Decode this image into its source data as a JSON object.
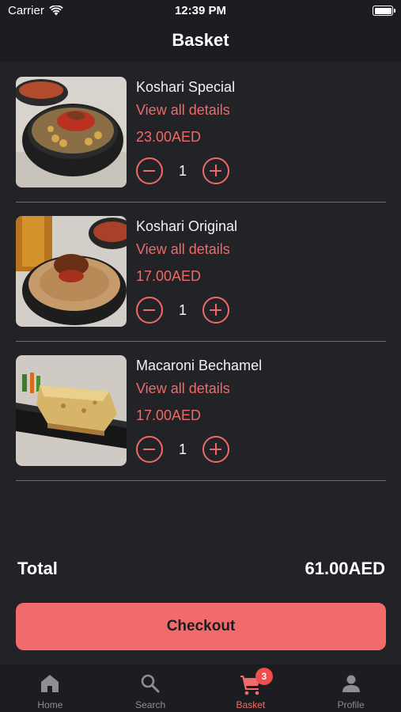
{
  "status_bar": {
    "carrier": "Carrier",
    "time": "12:39 PM"
  },
  "header": {
    "title": "Basket"
  },
  "items": [
    {
      "name": "Koshari Special",
      "link": "View all details",
      "price": "23.00AED",
      "quantity": "1",
      "image": "koshari-special-photo"
    },
    {
      "name": "Koshari Original",
      "link": "View all details",
      "price": "17.00AED",
      "quantity": "1",
      "image": "koshari-original-photo"
    },
    {
      "name": "Macaroni Bechamel",
      "link": "View all details",
      "price": "17.00AED",
      "quantity": "1",
      "image": "macaroni-bechamel-photo"
    }
  ],
  "summary": {
    "total_label": "Total",
    "total_value": "61.00AED"
  },
  "checkout": {
    "label": "Checkout"
  },
  "tabs": [
    {
      "label": "Home",
      "icon": "home-icon"
    },
    {
      "label": "Search",
      "icon": "search-icon"
    },
    {
      "label": "Basket",
      "icon": "cart-icon",
      "badge": "3",
      "active": true
    },
    {
      "label": "Profile",
      "icon": "person-icon"
    }
  ],
  "colors": {
    "accent": "#f26b6b",
    "background": "#222326",
    "bar": "#1c1d20",
    "inactive": "#8e8e93"
  }
}
